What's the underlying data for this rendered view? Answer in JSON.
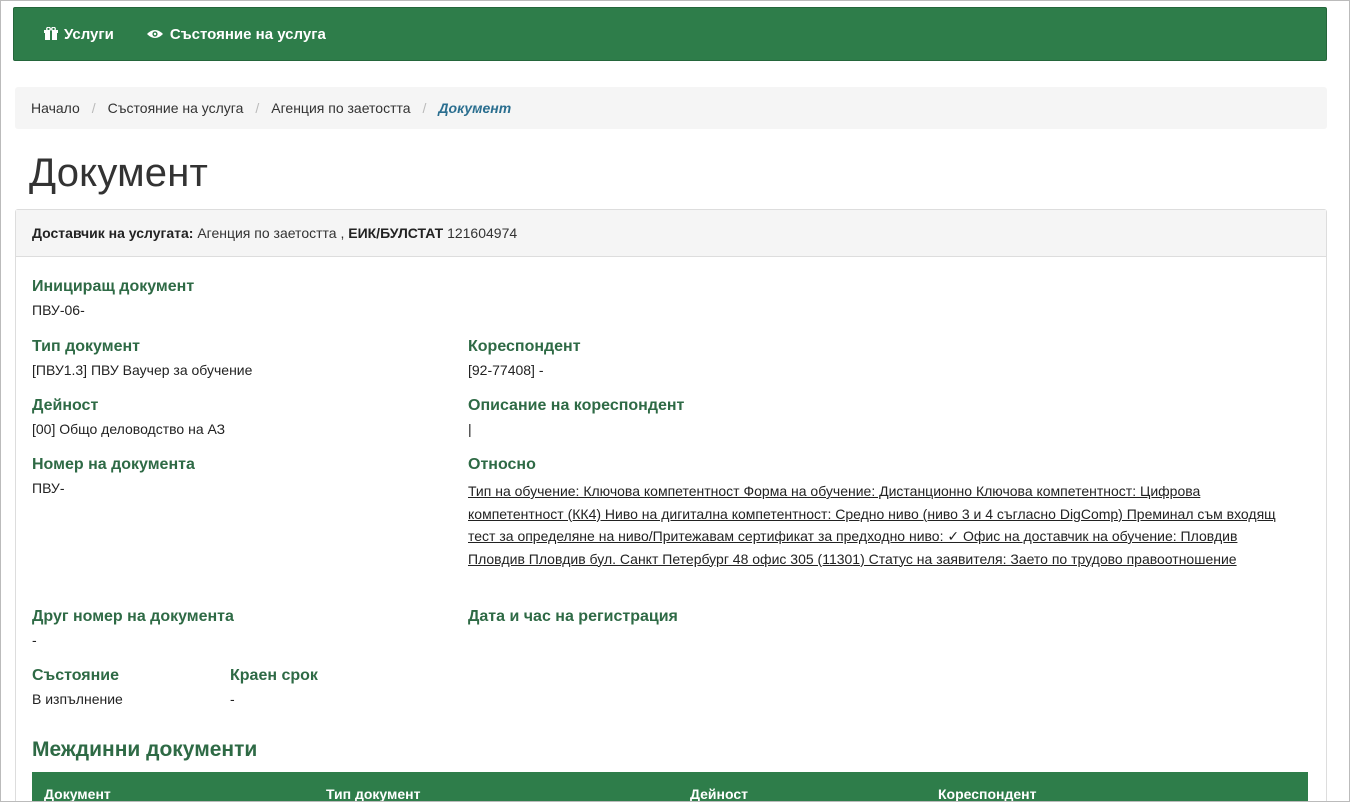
{
  "navbar": {
    "items": [
      {
        "label": "Услуги",
        "icon": "gift-icon"
      },
      {
        "label": "Състояние на услуга",
        "icon": "eye-icon"
      }
    ]
  },
  "breadcrumb": {
    "items": [
      "Начало",
      "Състояние на услуга",
      "Агенция по заетостта"
    ],
    "active": "Документ",
    "separator": "/"
  },
  "page": {
    "title": "Документ"
  },
  "provider": {
    "label": "Доставчик на услугата:",
    "name": "Агенция по заетостта ,",
    "eik_label": "ЕИК/БУЛСТАТ",
    "eik": "121604974"
  },
  "fields": {
    "initiating_doc": {
      "label": "Инициращ документ",
      "value": "ПВУ-06-"
    },
    "doc_type": {
      "label": "Тип документ",
      "value": "[ПВУ1.3] ПВУ Ваучер за обучение"
    },
    "correspondent": {
      "label": "Кореспондент",
      "value": "[92-77408] -"
    },
    "activity": {
      "label": "Дейност",
      "value": "[00] Общо деловодство на АЗ"
    },
    "correspondent_desc": {
      "label": "Описание на кореспондент",
      "value": "|"
    },
    "doc_number": {
      "label": "Номер на документа",
      "value": "ПВУ-"
    },
    "regarding": {
      "label": "Относно",
      "value": "Тип на обучение: Ключова компетентност Форма на обучение: Дистанционно Ключова компетентност: Цифрова компетентност (КК4) Ниво на дигитална компетентност: Средно ниво (ниво 3 и 4 съгласно DigComp) Преминал съм входящ тест за определяне на ниво/Притежавам сертификат за предходно ниво: ✓ Офис на доставчик на обучение: Пловдив Пловдив Пловдив бул. Санкт Петербург 48 офис 305 (11301) Статус на заявителя: Заето по трудово правоотношение"
    },
    "other_number": {
      "label": "Друг номер на документа",
      "value": "-"
    },
    "registered_at": {
      "label": "Дата и час на регистрация",
      "value": ""
    },
    "state": {
      "label": "Състояние",
      "value": "В изпълнение"
    },
    "deadline": {
      "label": "Краен срок",
      "value": "-"
    }
  },
  "intermediate": {
    "title": "Междинни документи",
    "columns": [
      "Документ",
      "Тип документ",
      "Дейност",
      "Кореспондент"
    ]
  },
  "colors": {
    "primary_green": "#2e7d4a",
    "label_green": "#2e6a45",
    "breadcrumb_active": "#2a6e8f"
  }
}
